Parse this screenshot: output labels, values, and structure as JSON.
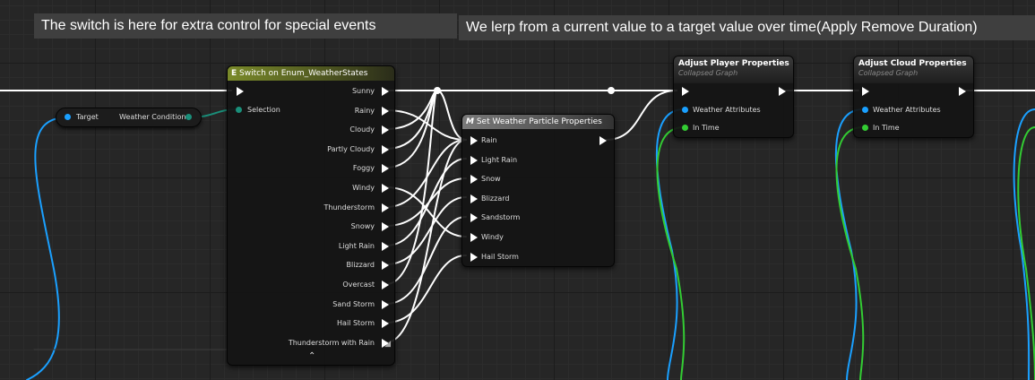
{
  "comments": {
    "switch_comment": "The switch is here for extra control for special events",
    "lerp_comment": "We lerp from a current value to a target value over time(Apply Remove Duration)"
  },
  "target_node": {
    "input": "Target",
    "output": "Weather Condition"
  },
  "switch_node": {
    "icon": "E",
    "title": "Switch on Enum_WeatherStates",
    "selection": "Selection",
    "outputs": [
      "Sunny",
      "Rainy",
      "Cloudy",
      "Partly Cloudy",
      "Foggy",
      "Windy",
      "Thunderstorm",
      "Snowy",
      "Light Rain",
      "Blizzard",
      "Overcast",
      "Sand Storm",
      "Hail Storm",
      "Thunderstorm with Rain"
    ],
    "expand_glyph": "⌃"
  },
  "particle_node": {
    "icon": "M",
    "title": "Set Weather Particle Properties",
    "inputs": [
      "Rain",
      "Light Rain",
      "Snow",
      "Blizzard",
      "Sandstorm",
      "Windy",
      "Hail Storm"
    ]
  },
  "player_node": {
    "title": "Adjust Player Properties",
    "subtitle": "Collapsed Graph",
    "pin_attr": "Weather Attributes",
    "pin_time": "In Time"
  },
  "cloud_node": {
    "title": "Adjust Cloud Properties",
    "subtitle": "Collapsed Graph",
    "pin_attr": "Weather Attributes",
    "pin_time": "In Time"
  },
  "colors": {
    "exec": "#ffffff",
    "struct_pin": "#1aa0ff",
    "enum_pin": "#1a8f7a",
    "float_pin": "#33cc33",
    "switch_header": "#7a8a2a"
  }
}
